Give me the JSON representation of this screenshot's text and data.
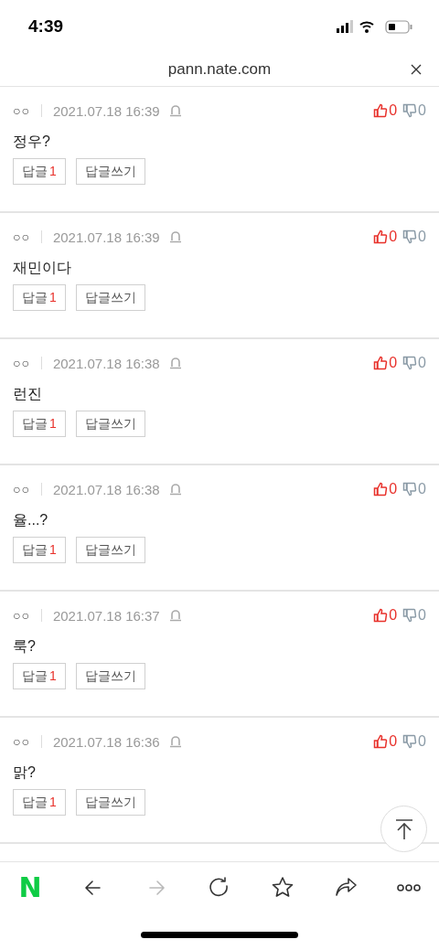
{
  "status_bar": {
    "time": "4:39"
  },
  "browser_header": {
    "url": "pann.nate.com"
  },
  "comments": [
    {
      "author": "○○",
      "date": "2021.07.18 16:39",
      "text": "정우?",
      "likes": "0",
      "dislikes": "0",
      "reply_label": "답글",
      "reply_count": "1",
      "write_reply": "답글쓰기"
    },
    {
      "author": "○○",
      "date": "2021.07.18 16:39",
      "text": "재민이다",
      "likes": "0",
      "dislikes": "0",
      "reply_label": "답글",
      "reply_count": "1",
      "write_reply": "답글쓰기"
    },
    {
      "author": "○○",
      "date": "2021.07.18 16:38",
      "text": "런진",
      "likes": "0",
      "dislikes": "0",
      "reply_label": "답글",
      "reply_count": "1",
      "write_reply": "답글쓰기"
    },
    {
      "author": "○○",
      "date": "2021.07.18 16:38",
      "text": "율...?",
      "likes": "0",
      "dislikes": "0",
      "reply_label": "답글",
      "reply_count": "1",
      "write_reply": "답글쓰기"
    },
    {
      "author": "○○",
      "date": "2021.07.18 16:37",
      "text": "룩?",
      "likes": "0",
      "dislikes": "0",
      "reply_label": "답글",
      "reply_count": "1",
      "write_reply": "답글쓰기"
    },
    {
      "author": "○○",
      "date": "2021.07.18 16:36",
      "text": "맑?",
      "likes": "0",
      "dislikes": "0",
      "reply_label": "답글",
      "reply_count": "1",
      "write_reply": "답글쓰기"
    }
  ],
  "toolbar": [
    {
      "kind": "logo",
      "label": "N"
    },
    {
      "kind": "back"
    },
    {
      "kind": "forward",
      "disabled": true
    },
    {
      "kind": "reload"
    },
    {
      "kind": "bookmark"
    },
    {
      "kind": "share"
    },
    {
      "kind": "more"
    }
  ]
}
